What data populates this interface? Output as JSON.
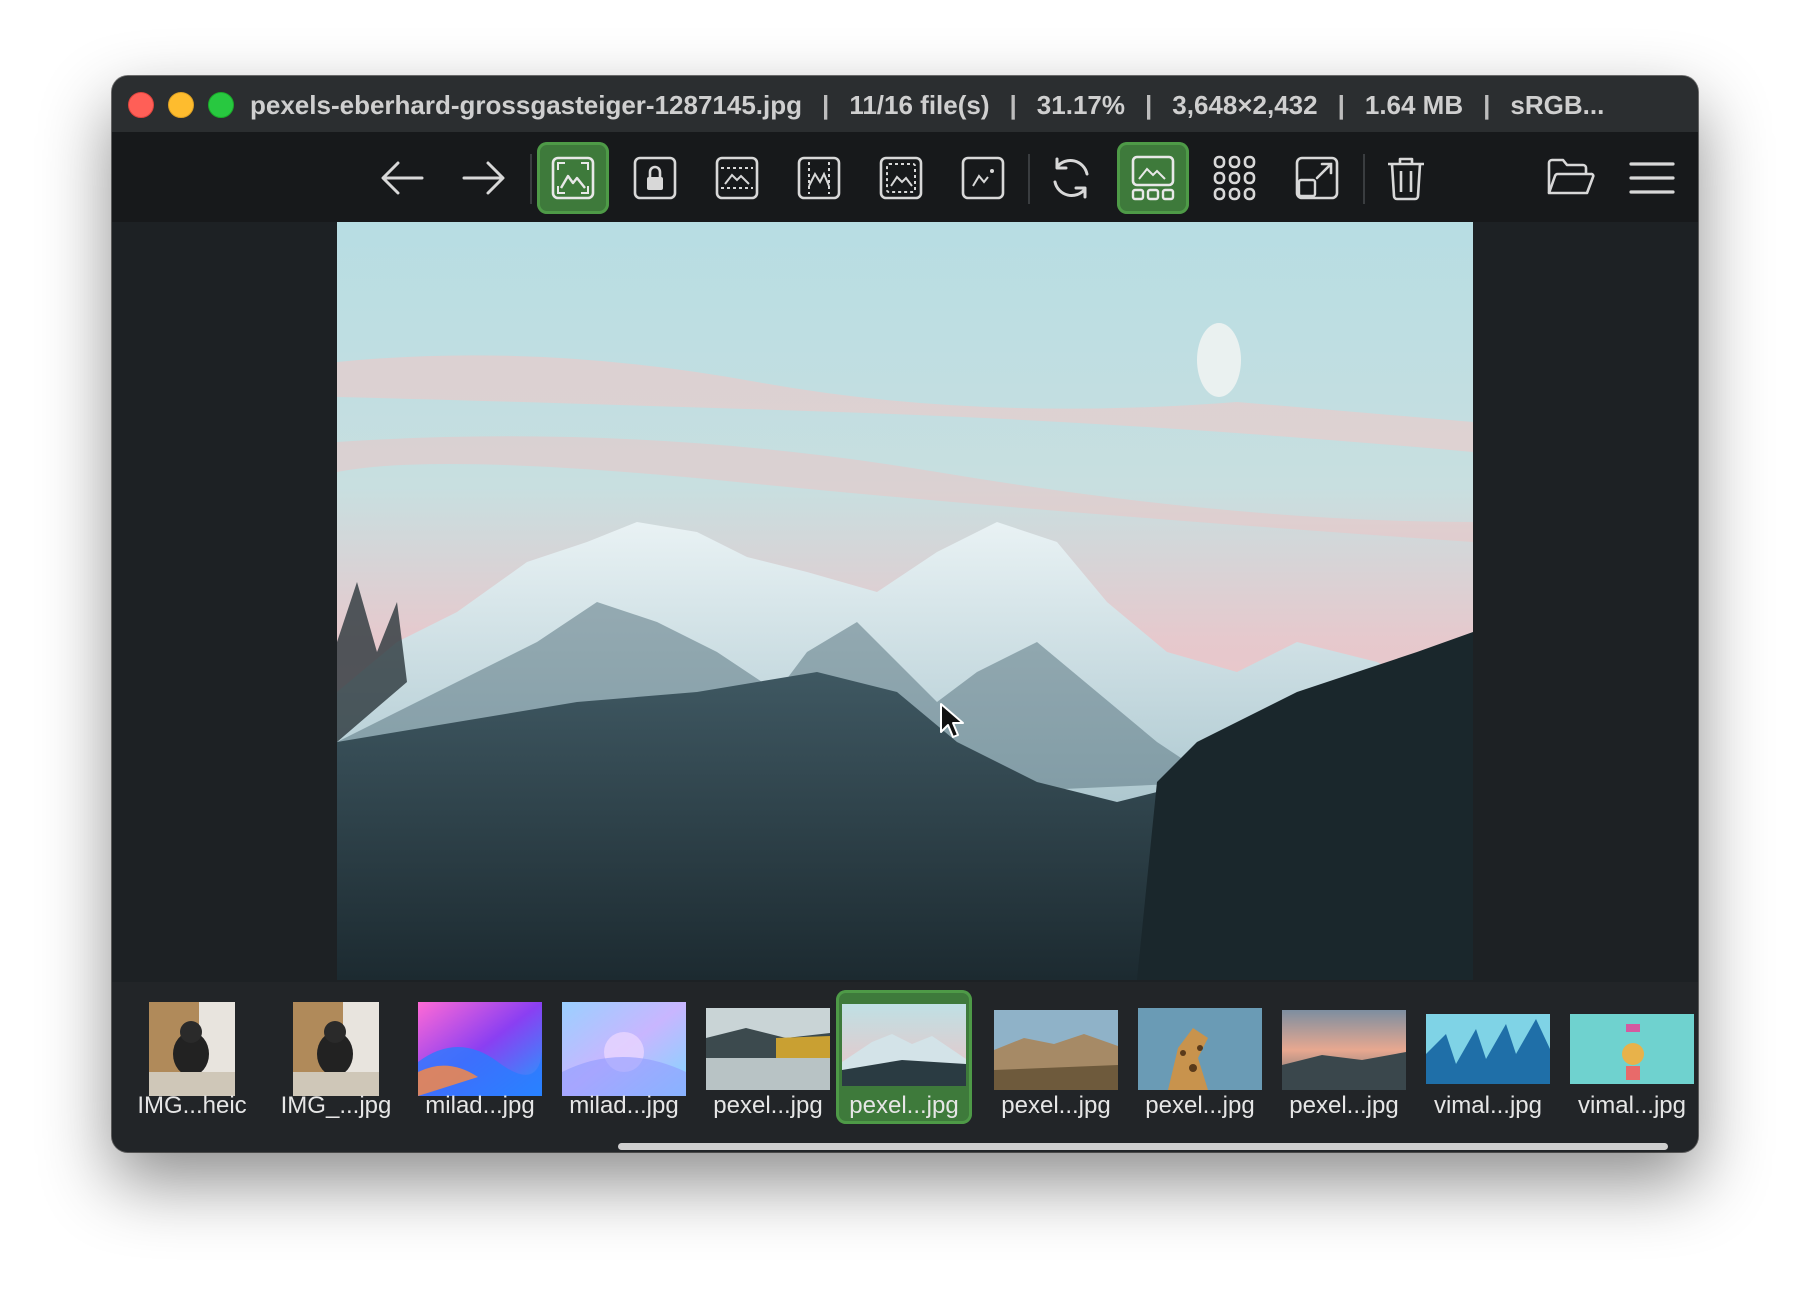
{
  "window": {
    "title_parts": [
      "pexels-eberhard-grossgasteiger-1287145.jpg",
      "11/16 file(s)",
      "31.17%",
      "3,648×2,432",
      "1.64 MB",
      "sRGB..."
    ],
    "separator": "|"
  },
  "toolbar": {
    "buttons": [
      {
        "name": "back-arrow-icon",
        "active": false
      },
      {
        "name": "forward-arrow-icon",
        "active": false
      },
      {
        "name": "auto-zoom-icon",
        "active": true
      },
      {
        "name": "lock-zoom-icon",
        "active": false
      },
      {
        "name": "scale-width-icon",
        "active": false
      },
      {
        "name": "scale-height-icon",
        "active": false
      },
      {
        "name": "fill-window-icon",
        "active": false
      },
      {
        "name": "original-size-icon",
        "active": false
      },
      {
        "name": "refresh-icon",
        "active": false
      },
      {
        "name": "thumbnail-bar-icon",
        "active": true
      },
      {
        "name": "gallery-grid-icon",
        "active": false
      },
      {
        "name": "fullscreen-icon",
        "active": false
      },
      {
        "name": "trash-icon",
        "active": false
      },
      {
        "name": "open-folder-icon",
        "active": false
      },
      {
        "name": "menu-icon",
        "active": false
      }
    ]
  },
  "filmstrip": {
    "thumbnails": [
      {
        "label": "IMG...heic",
        "selected": false
      },
      {
        "label": "IMG_...jpg",
        "selected": false
      },
      {
        "label": "milad...jpg",
        "selected": false
      },
      {
        "label": "milad...jpg",
        "selected": false
      },
      {
        "label": "pexel...jpg",
        "selected": false
      },
      {
        "label": "pexel...jpg",
        "selected": true
      },
      {
        "label": "pexel...jpg",
        "selected": false
      },
      {
        "label": "pexel...jpg",
        "selected": false
      },
      {
        "label": "pexel...jpg",
        "selected": false
      },
      {
        "label": "vimal...jpg",
        "selected": false
      },
      {
        "label": "vimal...jpg",
        "selected": false
      }
    ]
  },
  "colors": {
    "accent_active": "#3e7a3b",
    "window_bg": "#1d2124",
    "titlebar_bg": "#2b2e30"
  }
}
